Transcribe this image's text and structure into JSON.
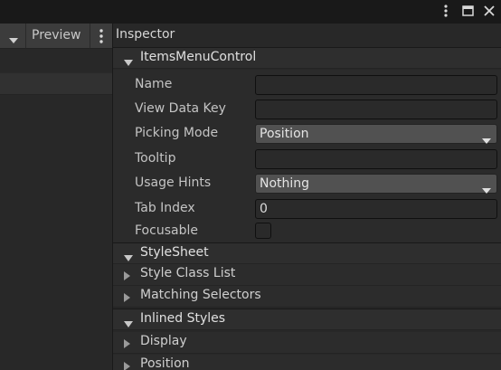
{
  "window": {
    "icons": [
      "kebab-menu-icon",
      "maximize-icon",
      "close-icon"
    ]
  },
  "left_panel": {
    "preview_label": "Preview"
  },
  "inspector": {
    "title": "Inspector",
    "component": {
      "name": "ItemsMenuControl",
      "properties": [
        {
          "label": "Name",
          "type": "text",
          "value": ""
        },
        {
          "label": "View Data Key",
          "type": "text",
          "value": ""
        },
        {
          "label": "Picking Mode",
          "type": "dropdown",
          "value": "Position"
        },
        {
          "label": "Tooltip",
          "type": "text",
          "value": ""
        },
        {
          "label": "Usage Hints",
          "type": "dropdown",
          "value": "Nothing"
        },
        {
          "label": "Tab Index",
          "type": "text",
          "value": "0"
        },
        {
          "label": "Focusable",
          "type": "checkbox",
          "value": false
        }
      ]
    },
    "stylesheet": {
      "label": "StyleSheet",
      "items": [
        {
          "label": "Style Class List"
        },
        {
          "label": "Matching Selectors"
        }
      ]
    },
    "inlined_styles": {
      "label": "Inlined Styles",
      "items": [
        {
          "label": "Display"
        },
        {
          "label": "Position"
        }
      ]
    }
  },
  "colors": {
    "background": "#282828",
    "header_bg": "#2e2e2e",
    "dropdown_bg": "#515151",
    "field_bg": "#2a2a2a",
    "text": "#d2d2d2"
  }
}
